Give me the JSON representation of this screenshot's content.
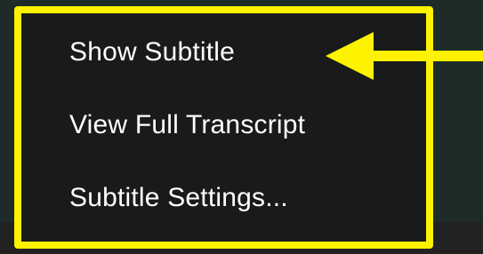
{
  "menu": {
    "items": [
      {
        "label": "Show Subtitle"
      },
      {
        "label": "View Full Transcript"
      },
      {
        "label": "Subtitle Settings..."
      }
    ]
  },
  "annotation": {
    "highlight_color": "#fff200",
    "arrow_target": "Show Subtitle"
  },
  "colors": {
    "menu_background": "#1a1a1a",
    "page_background": "#1f2b28",
    "text": "#ffffff"
  }
}
